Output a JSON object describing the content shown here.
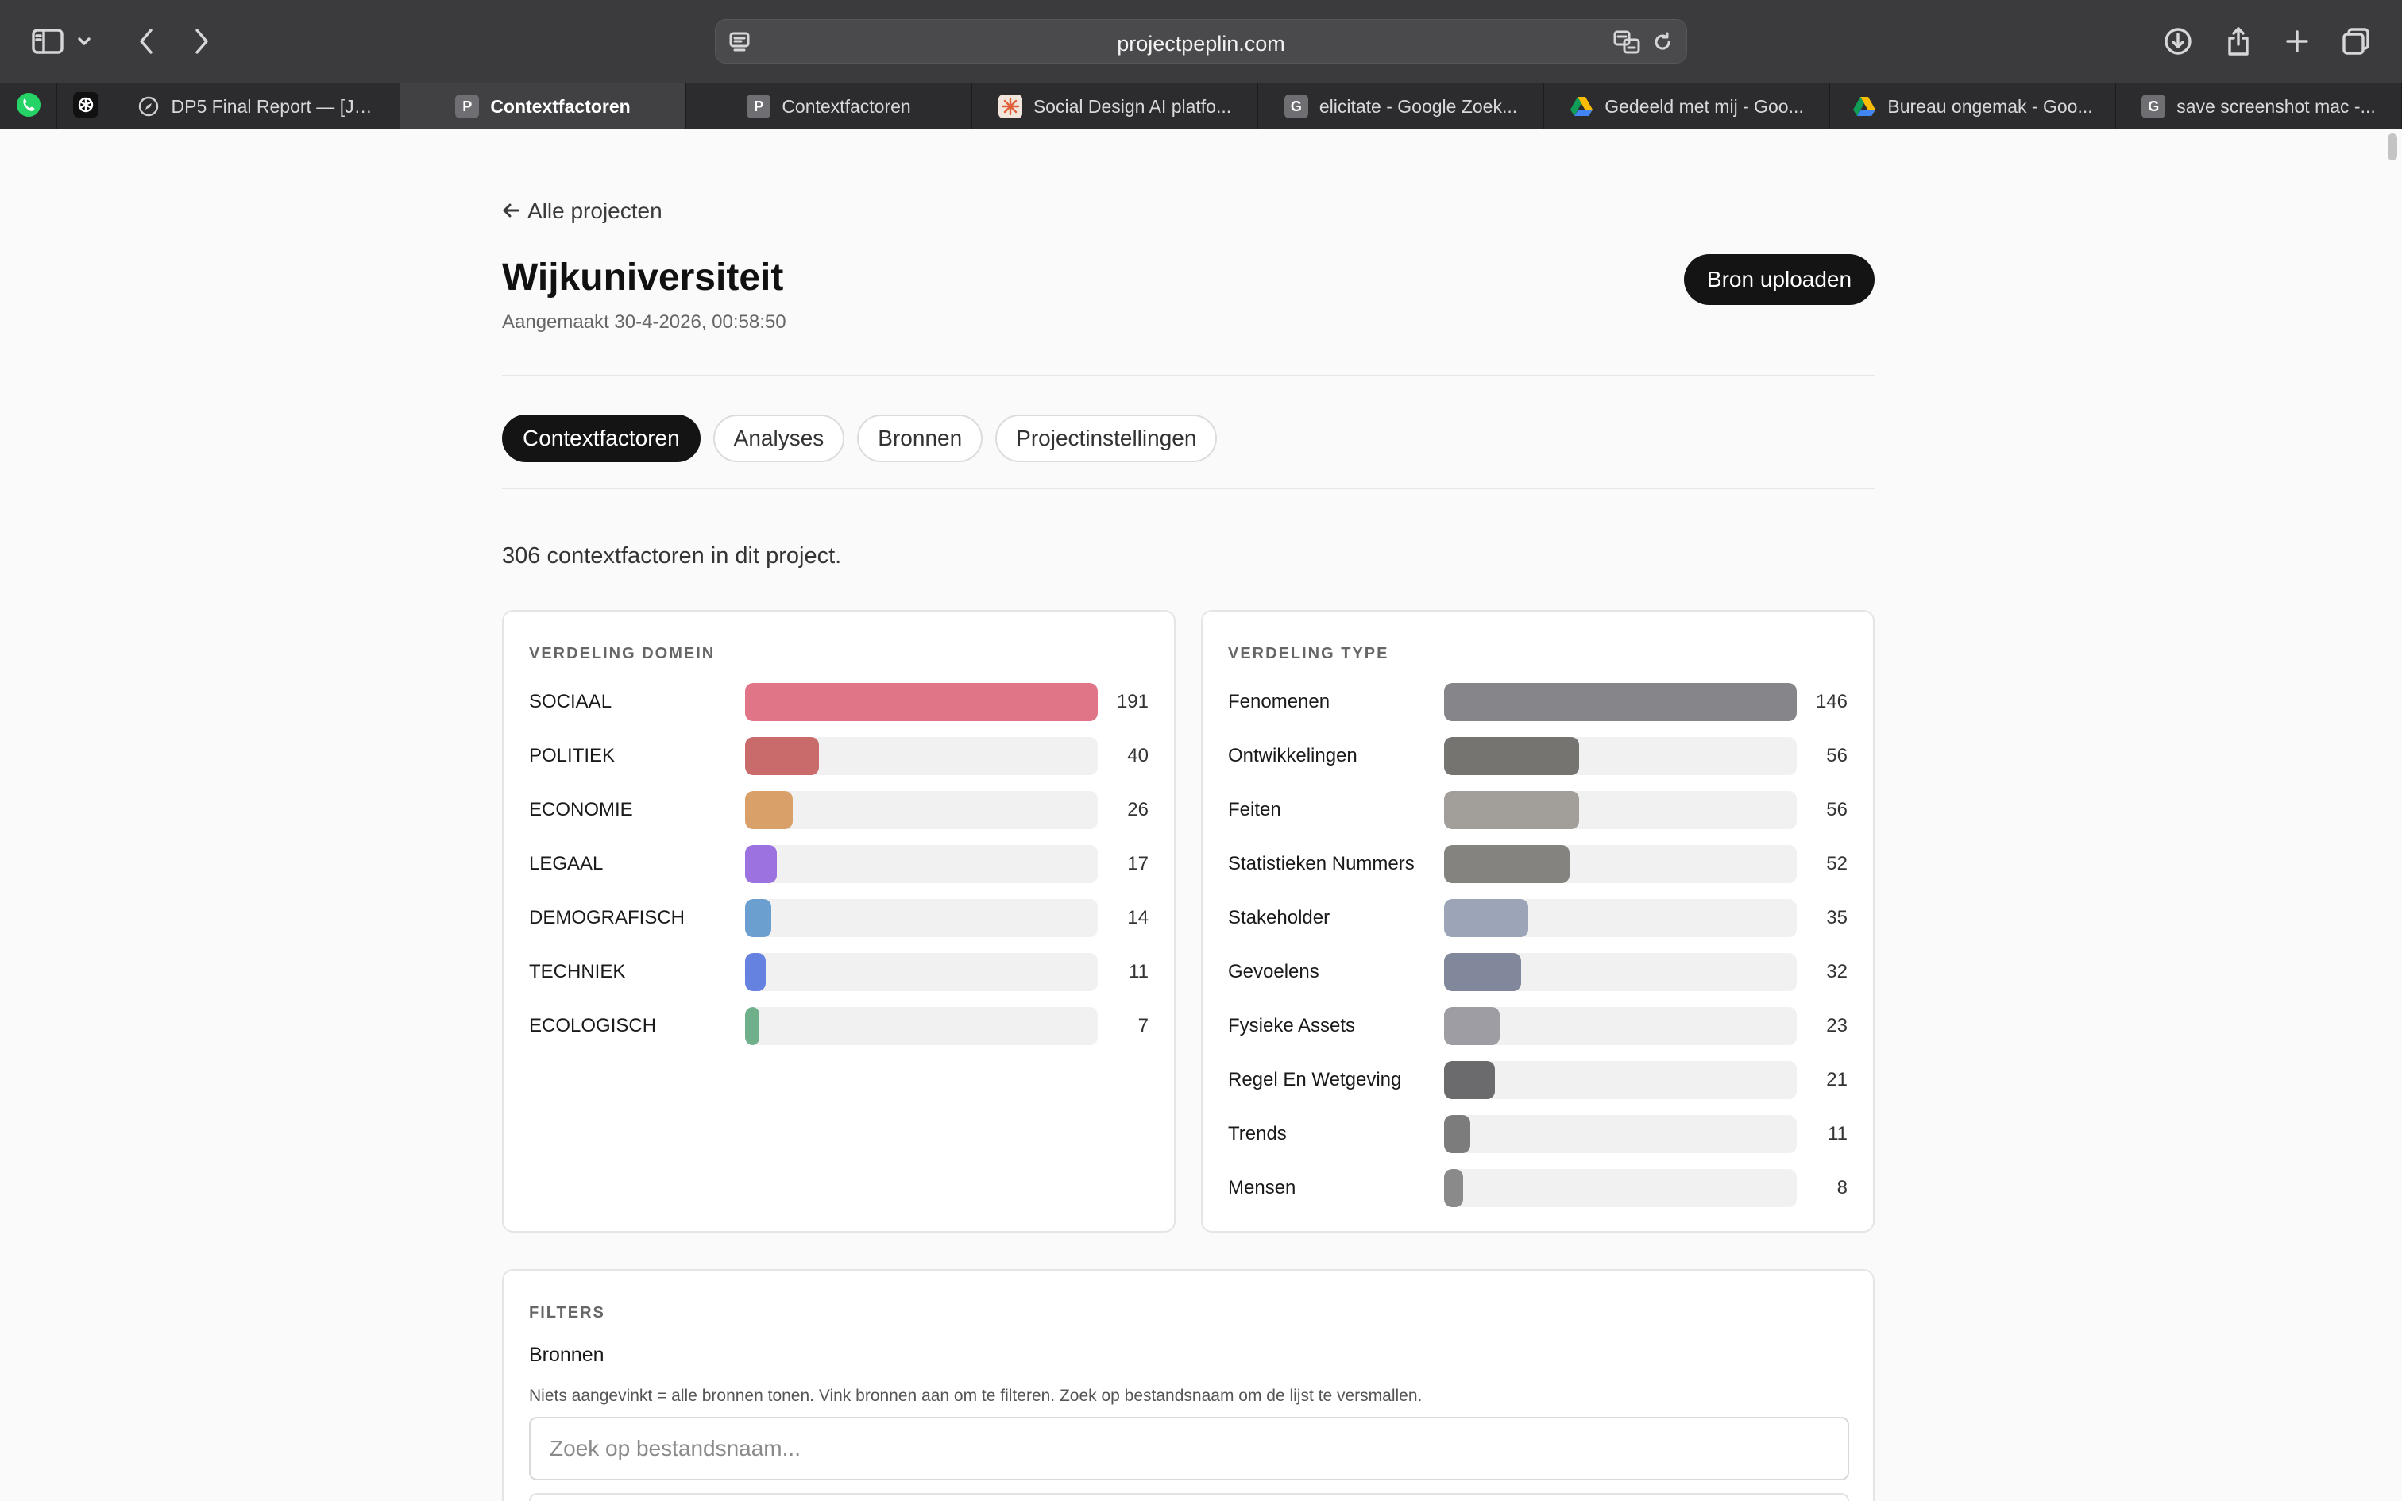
{
  "browser": {
    "url": "projectpeplin.com",
    "pinned": [
      {
        "name": "whatsapp",
        "color": "#25d366"
      },
      {
        "name": "chatgpt",
        "color": "#ffffff"
      }
    ],
    "tabs": [
      {
        "label": "DP5 Final Report — [Jo...",
        "icon": "compass-icon",
        "favicon_color": "#2c2c2e",
        "favicon_letter": "",
        "active": false
      },
      {
        "label": "Contextfactoren",
        "icon": "p-favicon",
        "favicon_color": "#6e6e73",
        "favicon_letter": "P",
        "active": true
      },
      {
        "label": "Contextfactoren",
        "icon": "p-favicon",
        "favicon_color": "#6e6e73",
        "favicon_letter": "P",
        "active": false
      },
      {
        "label": "Social Design AI platfo...",
        "icon": "starburst-icon",
        "favicon_color": "#f2e6dc",
        "favicon_letter": "",
        "active": false
      },
      {
        "label": "elicitate - Google Zoek...",
        "icon": "g-favicon",
        "favicon_color": "#6e6e73",
        "favicon_letter": "G",
        "active": false
      },
      {
        "label": "Gedeeld met mij - Goo...",
        "icon": "google-drive-icon",
        "favicon_color": "",
        "favicon_letter": "",
        "active": false
      },
      {
        "label": "Bureau ongemak - Goo...",
        "icon": "google-drive-icon",
        "favicon_color": "",
        "favicon_letter": "",
        "active": false
      },
      {
        "label": "save screenshot mac -...",
        "icon": "g-favicon",
        "favicon_color": "#6e6e73",
        "favicon_letter": "G",
        "active": false
      }
    ]
  },
  "project": {
    "back_label": "Alle projecten",
    "title": "Wijkuniversiteit",
    "created": "Aangemaakt 30-4-2026, 00:58:50",
    "upload_label": "Bron uploaden"
  },
  "nav_tabs": [
    {
      "label": "Contextfactoren",
      "active": true
    },
    {
      "label": "Analyses",
      "active": false
    },
    {
      "label": "Bronnen",
      "active": false
    },
    {
      "label": "Projectinstellingen",
      "active": false
    }
  ],
  "summary": "306 contextfactoren in dit project.",
  "chart_data": [
    {
      "type": "bar",
      "title": "VERDELING DOMEIN",
      "orientation": "horizontal",
      "max": 191,
      "categories": [
        "SOCIAAL",
        "POLITIEK",
        "ECONOMIE",
        "LEGAAL",
        "DEMOGRAFISCH",
        "TECHNIEK",
        "ECOLOGISCH"
      ],
      "values": [
        191,
        40,
        26,
        17,
        14,
        11,
        7
      ],
      "colors": [
        "#e07587",
        "#c96b6b",
        "#d9a06a",
        "#9b72e0",
        "#6a9fd0",
        "#6682e0",
        "#6fb08b"
      ]
    },
    {
      "type": "bar",
      "title": "VERDELING TYPE",
      "orientation": "horizontal",
      "max": 146,
      "categories": [
        "Fenomenen",
        "Ontwikkelingen",
        "Feiten",
        "Statistieken Nummers",
        "Stakeholder",
        "Gevoelens",
        "Fysieke Assets",
        "Regel En Wetgeving",
        "Trends",
        "Mensen"
      ],
      "values": [
        146,
        56,
        56,
        52,
        35,
        32,
        23,
        21,
        11,
        8
      ],
      "colors": [
        "#86858a",
        "#767471",
        "#a29e99",
        "#858380",
        "#9ba5b7",
        "#81889b",
        "#9d9da3",
        "#6b6b6d",
        "#7c7c7c",
        "#8a8a8a"
      ]
    }
  ],
  "filters": {
    "title": "FILTERS",
    "subtitle": "Bronnen",
    "hint": "Niets aangevinkt = alle bronnen tonen. Vink bronnen aan om te filteren. Zoek op bestandsnaam om de lijst te versmallen.",
    "search_placeholder": "Zoek op bestandsnaam..."
  }
}
